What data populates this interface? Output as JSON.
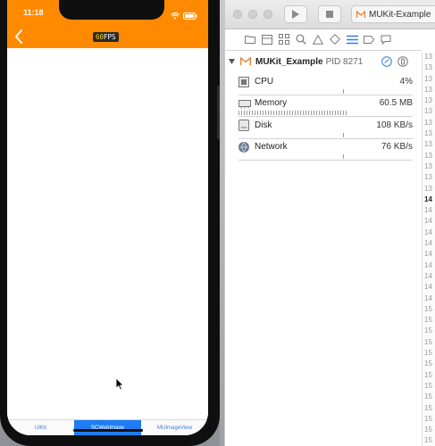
{
  "phone": {
    "status_time": "11:18",
    "fps_value": "60",
    "fps_label": "FPS",
    "nav_color": "#ff8a00",
    "tabs": [
      {
        "label": "UIKit",
        "active": false
      },
      {
        "label": "SCWebImage",
        "active": true
      },
      {
        "label": "MUImageView",
        "active": false
      }
    ]
  },
  "xcode": {
    "scheme_name": "MUKit-Example",
    "process": {
      "name": "MUKit_Example",
      "pid_label": "PID 8271"
    },
    "gauges": [
      {
        "label": "CPU",
        "value": "4%",
        "icon": "cpu-icon",
        "level": 0.04
      },
      {
        "label": "Memory",
        "value": "60.5 MB",
        "icon": "memory-icon",
        "level": 0.62
      },
      {
        "label": "Disk",
        "value": "108 KB/s",
        "icon": "disk-icon",
        "level": 0.01
      },
      {
        "label": "Network",
        "value": "76 KB/s",
        "icon": "network-icon",
        "level": 0.01
      }
    ],
    "line_numbers": [
      "13",
      "13",
      "13",
      "13",
      "13",
      "13",
      "13",
      "13",
      "13",
      "13",
      "13",
      "13",
      "13",
      "14",
      "14",
      "14",
      "14",
      "14",
      "14",
      "14",
      "14",
      "14",
      "14",
      "15",
      "15",
      "15",
      "15",
      "15",
      "15",
      "15",
      "15",
      "15",
      "15",
      "15",
      "15",
      "15",
      "15"
    ],
    "current_line_index": 13
  }
}
